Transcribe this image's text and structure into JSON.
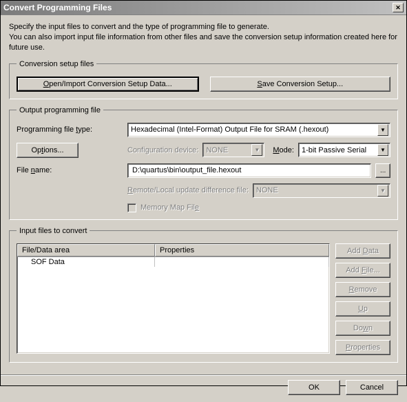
{
  "window": {
    "title": "Convert Programming Files",
    "close": "✕"
  },
  "intro": "Specify the input files to convert and the type of programming file to generate.\nYou can also import input file information from other files and save the conversion setup information created here for future use.",
  "setup": {
    "legend": "Conversion setup files",
    "open": "Open/Import Conversion Setup Data...",
    "save": "Save Conversion Setup..."
  },
  "output": {
    "legend": "Output programming file",
    "file_type_label": "Programming file type:",
    "file_type_value": "Hexadecimal (Intel-Format) Output File for SRAM (.hexout)",
    "options_btn": "Options...",
    "config_device_label": "Configuration device:",
    "config_device_value": "NONE",
    "mode_label": "Mode:",
    "mode_value": "1-bit Passive Serial",
    "file_name_label": "File name:",
    "file_name_value": "D:\\quartus\\bin\\output_file.hexout",
    "browse_btn": "...",
    "remote_label": "Remote/Local update difference file:",
    "remote_value": "NONE",
    "memory_map_label": "Memory Map File"
  },
  "input": {
    "legend": "Input files to convert",
    "col_file": "File/Data area",
    "col_props": "Properties",
    "rows": [
      {
        "file": "SOF Data",
        "props": ""
      }
    ],
    "btn_add_data": "Add Data",
    "btn_add_file": "Add File...",
    "btn_remove": "Remove",
    "btn_up": "Up",
    "btn_down": "Down",
    "btn_properties": "Properties"
  },
  "dlg": {
    "ok": "OK",
    "cancel": "Cancel"
  }
}
